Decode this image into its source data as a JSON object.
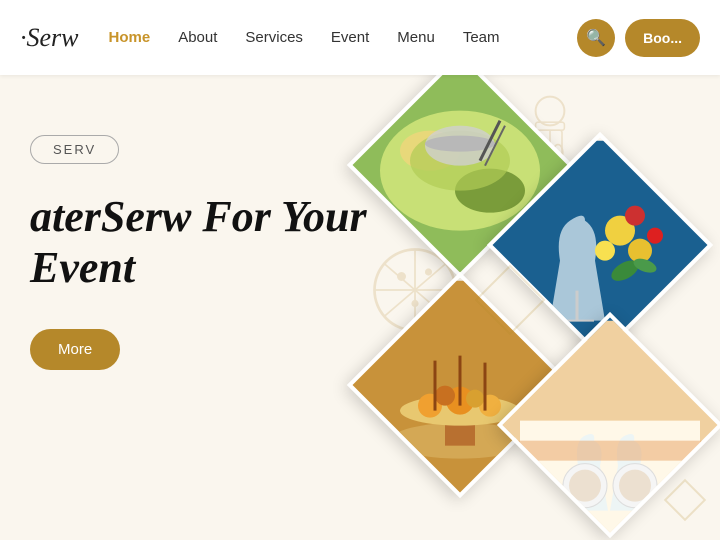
{
  "logo": {
    "text": "·Serw"
  },
  "nav": {
    "items": [
      {
        "label": "Home",
        "active": true
      },
      {
        "label": "About",
        "active": false
      },
      {
        "label": "Services",
        "active": false
      },
      {
        "label": "Event",
        "active": false
      },
      {
        "label": "Menu",
        "active": false
      },
      {
        "label": "Team",
        "active": false
      }
    ]
  },
  "header": {
    "book_label": "Boo..."
  },
  "hero": {
    "badge": "SERV",
    "title_part1": "aterSerw For Your",
    "title_part2": "Event",
    "more_label": "More"
  },
  "colors": {
    "gold": "#b5882a",
    "bg": "#faf6ee"
  }
}
